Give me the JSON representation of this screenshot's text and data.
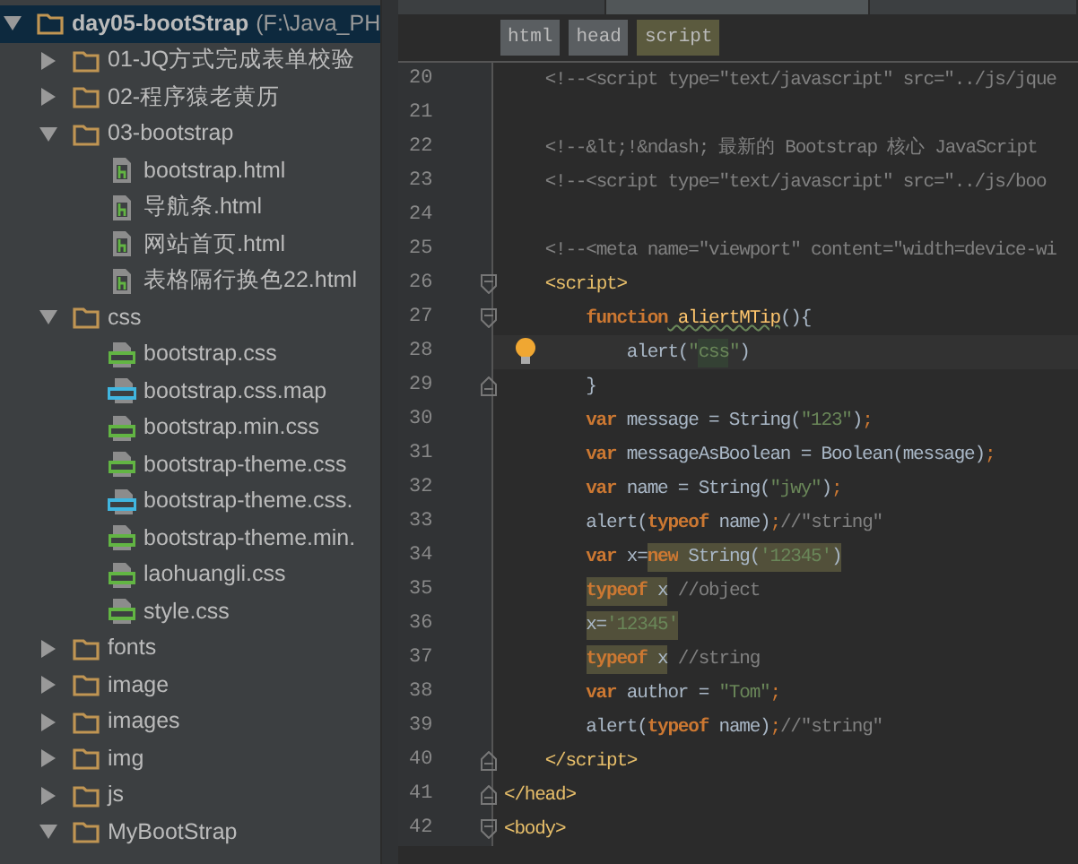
{
  "editor_tabs": [
    {
      "selected": false
    },
    {
      "selected": true
    },
    {
      "selected": false
    }
  ],
  "project_tree": [
    {
      "label": "day05-bootStrap",
      "path": "(F:\\Java_PH",
      "kind": "folder",
      "expanded": true,
      "selected": true,
      "children": [
        {
          "label": "01-JQ方式完成表单校验",
          "kind": "folder",
          "expanded": false,
          "selected": false
        },
        {
          "label": "02-程序猿老黄历",
          "kind": "folder",
          "expanded": false,
          "selected": false
        },
        {
          "label": "03-bootstrap",
          "kind": "folder",
          "expanded": true,
          "selected": false,
          "children": [
            {
              "label": "bootstrap.html",
              "kind": "html",
              "selected": false
            },
            {
              "label": "导航条.html",
              "kind": "html",
              "selected": false
            },
            {
              "label": "网站首页.html",
              "kind": "html",
              "selected": false
            },
            {
              "label": "表格隔行换色22.html",
              "kind": "html",
              "selected": false
            }
          ]
        },
        {
          "label": "css",
          "kind": "folder",
          "expanded": true,
          "selected": false,
          "children": [
            {
              "label": "bootstrap.css",
              "kind": "css",
              "selected": false
            },
            {
              "label": "bootstrap.css.map",
              "kind": "json",
              "selected": false
            },
            {
              "label": "bootstrap.min.css",
              "kind": "css",
              "selected": false
            },
            {
              "label": "bootstrap-theme.css",
              "kind": "css",
              "selected": false
            },
            {
              "label": "bootstrap-theme.css.",
              "kind": "json",
              "selected": false
            },
            {
              "label": "bootstrap-theme.min.",
              "kind": "css",
              "selected": false
            },
            {
              "label": "laohuangli.css",
              "kind": "css",
              "selected": false
            },
            {
              "label": "style.css",
              "kind": "css",
              "selected": false
            }
          ]
        },
        {
          "label": "fonts",
          "kind": "folder",
          "expanded": false,
          "selected": false
        },
        {
          "label": "image",
          "kind": "folder",
          "expanded": false,
          "selected": false
        },
        {
          "label": "images",
          "kind": "folder",
          "expanded": false,
          "selected": false
        },
        {
          "label": "img",
          "kind": "folder",
          "expanded": false,
          "selected": false
        },
        {
          "label": "js",
          "kind": "folder",
          "expanded": false,
          "selected": false
        },
        {
          "label": "MyBootStrap",
          "kind": "folder",
          "expanded": true,
          "selected": false
        }
      ]
    }
  ],
  "breadcrumbs": [
    {
      "label": "html",
      "selected": false
    },
    {
      "label": "head",
      "selected": false
    },
    {
      "label": "script",
      "selected": true
    }
  ],
  "code_lines": [
    {
      "number": "20",
      "tokens": [
        {
          "text": "    <!--<script type=\"text/javascript\" src=\"../js/jque",
          "kind": "comment"
        }
      ]
    },
    {
      "number": "21"
    },
    {
      "number": "22",
      "tokens": [
        {
          "text": "    <!--&lt;!&ndash; 最新的 Bootstrap 核心 JavaScript",
          "kind": "comment"
        }
      ]
    },
    {
      "number": "23",
      "tokens": [
        {
          "text": "    <!--<script type=\"text/javascript\" src=\"../js/boo",
          "kind": "comment"
        }
      ]
    },
    {
      "number": "24"
    },
    {
      "number": "25",
      "tokens": [
        {
          "text": "    <!--<meta name=\"viewport\" content=\"width=device-wi",
          "kind": "comment"
        }
      ]
    },
    {
      "number": "26",
      "fold_start": true,
      "tokens": [
        {
          "text": "    <script>",
          "kind": "tag"
        }
      ]
    },
    {
      "number": "27",
      "fold_start": true,
      "tokens": [
        {
          "text": "        function",
          "kind": "keyword"
        },
        {
          "text": " aliertMTip",
          "kind": "function",
          "typo": true
        },
        {
          "text": "(){",
          "kind": "plain"
        }
      ]
    },
    {
      "number": "28",
      "current": true,
      "bulb": true,
      "tokens": [
        {
          "text": "            alert(",
          "kind": "plain"
        },
        {
          "text": "\"",
          "kind": "string"
        },
        {
          "text": "css",
          "kind": "string",
          "matched": true
        },
        {
          "text": "\"",
          "kind": "string"
        },
        {
          "text": ")",
          "kind": "plain"
        }
      ]
    },
    {
      "number": "29",
      "fold_end": true,
      "tokens": [
        {
          "text": "        }",
          "kind": "plain"
        }
      ]
    },
    {
      "number": "30",
      "tokens": [
        {
          "text": "        var",
          "kind": "keyword"
        },
        {
          "text": " message = String(",
          "kind": "plain"
        },
        {
          "text": "\"123\"",
          "kind": "string"
        },
        {
          "text": ")",
          "kind": "plain"
        },
        {
          "text": ";",
          "kind": "punct"
        }
      ]
    },
    {
      "number": "31",
      "tokens": [
        {
          "text": "        var",
          "kind": "keyword"
        },
        {
          "text": " messageAsBoolean = Boolean(message)",
          "kind": "plain"
        },
        {
          "text": ";",
          "kind": "punct"
        }
      ]
    },
    {
      "number": "32",
      "tokens": [
        {
          "text": "        var",
          "kind": "keyword"
        },
        {
          "text": " name = String(",
          "kind": "plain"
        },
        {
          "text": "\"jwy\"",
          "kind": "string"
        },
        {
          "text": ")",
          "kind": "plain"
        },
        {
          "text": ";",
          "kind": "punct"
        }
      ]
    },
    {
      "number": "33",
      "tokens": [
        {
          "text": "        alert(",
          "kind": "plain"
        },
        {
          "text": "typeof",
          "kind": "keyword"
        },
        {
          "text": " name)",
          "kind": "plain"
        },
        {
          "text": ";",
          "kind": "punct"
        },
        {
          "text": "//\"string\"",
          "kind": "comment"
        }
      ]
    },
    {
      "number": "34",
      "tokens": [
        {
          "text": "        var",
          "kind": "keyword"
        },
        {
          "text": " x=",
          "kind": "plain"
        },
        {
          "text": "new",
          "kind": "keyword",
          "highlighted": true
        },
        {
          "text": " String(",
          "kind": "plain",
          "highlighted": true
        },
        {
          "text": "'12345'",
          "kind": "string",
          "highlighted": true
        },
        {
          "text": ")",
          "kind": "plain",
          "highlighted": true
        }
      ]
    },
    {
      "number": "35",
      "tokens": [
        {
          "text": "        typeof",
          "kind": "keyword",
          "highlighted": true
        },
        {
          "text": " x",
          "kind": "plain",
          "highlighted": true
        },
        {
          "text": " //object",
          "kind": "comment"
        }
      ]
    },
    {
      "number": "36",
      "tokens": [
        {
          "text": "        x=",
          "kind": "plain",
          "highlighted": true
        },
        {
          "text": "'12345'",
          "kind": "string",
          "highlighted": true
        }
      ]
    },
    {
      "number": "37",
      "tokens": [
        {
          "text": "        typeof",
          "kind": "keyword",
          "highlighted": true
        },
        {
          "text": " x",
          "kind": "plain",
          "highlighted": true
        },
        {
          "text": " //string",
          "kind": "comment"
        }
      ]
    },
    {
      "number": "38",
      "tokens": [
        {
          "text": "        var",
          "kind": "keyword"
        },
        {
          "text": " author = ",
          "kind": "plain"
        },
        {
          "text": "\"Tom\"",
          "kind": "string"
        },
        {
          "text": ";",
          "kind": "punct"
        }
      ]
    },
    {
      "number": "39",
      "tokens": [
        {
          "text": "        alert(",
          "kind": "plain"
        },
        {
          "text": "typeof",
          "kind": "keyword"
        },
        {
          "text": " name)",
          "kind": "plain"
        },
        {
          "text": ";",
          "kind": "punct"
        },
        {
          "text": "//\"string\"",
          "kind": "comment"
        }
      ]
    },
    {
      "number": "40",
      "fold_end": true,
      "tokens": [
        {
          "text": "    </script>",
          "kind": "tag"
        }
      ]
    },
    {
      "number": "41",
      "fold_end": true,
      "tokens": [
        {
          "text": "</head>",
          "kind": "tag"
        }
      ]
    },
    {
      "number": "42",
      "fold_start": true,
      "tokens": [
        {
          "text": "<body>",
          "kind": "tag"
        }
      ]
    }
  ]
}
